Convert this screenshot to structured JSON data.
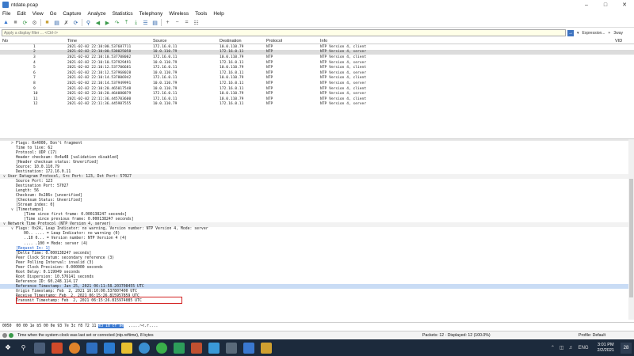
{
  "window": {
    "title": "ntdate.pcap"
  },
  "menu": [
    "File",
    "Edit",
    "View",
    "Go",
    "Capture",
    "Analyze",
    "Statistics",
    "Telephony",
    "Wireless",
    "Tools",
    "Help"
  ],
  "filter": {
    "placeholder": "Apply a display filter ... <Ctrl-/>",
    "expression_label": "Expression...",
    "plus_label": "+",
    "tvoy_label": "3way"
  },
  "packet_list": {
    "columns": [
      "No",
      "Time",
      "Source",
      "Destination",
      "Protocol",
      "Info",
      "VID"
    ],
    "rows": [
      {
        "no": "1",
        "time": "2021-02-02 22:10:00.537687711",
        "src": "172.16.0.11",
        "dst": "10.0.110.79",
        "proto": "NTP",
        "info": "NTP Version 4, client"
      },
      {
        "no": "2",
        "time": "2021-02-02 22:10:00.538025058",
        "src": "10.0.110.79",
        "dst": "172.16.0.11",
        "proto": "NTP",
        "info": "NTP Version 4, server"
      },
      {
        "no": "3",
        "time": "2021-02-02 22:10:10.537708002",
        "src": "172.16.0.11",
        "dst": "10.0.110.79",
        "proto": "NTP",
        "info": "NTP Version 4, client"
      },
      {
        "no": "4",
        "time": "2021-02-02 22:10:10.537929491",
        "src": "10.0.110.79",
        "dst": "172.16.0.11",
        "proto": "NTP",
        "info": "NTP Version 4, server"
      },
      {
        "no": "5",
        "time": "2021-02-02 22:10:12.537706681",
        "src": "172.16.0.11",
        "dst": "10.0.110.79",
        "proto": "NTP",
        "info": "NTP Version 4, client"
      },
      {
        "no": "6",
        "time": "2021-02-02 22:10:12.537968028",
        "src": "10.0.110.79",
        "dst": "172.16.0.11",
        "proto": "NTP",
        "info": "NTP Version 4, server"
      },
      {
        "no": "7",
        "time": "2021-02-02 22:10:14.537806942",
        "src": "172.16.0.11",
        "dst": "10.0.110.79",
        "proto": "NTP",
        "info": "NTP Version 4, client"
      },
      {
        "no": "8",
        "time": "2021-02-02 22:10:14.537949991",
        "src": "10.0.110.79",
        "dst": "172.16.0.11",
        "proto": "NTP",
        "info": "NTP Version 4, server"
      },
      {
        "no": "9",
        "time": "2021-02-02 22:10:20.465017548",
        "src": "10.0.110.79",
        "dst": "172.16.0.11",
        "proto": "NTP",
        "info": "NTP Version 4, client"
      },
      {
        "no": "10",
        "time": "2021-02-02 22:10:20.464080879",
        "src": "172.16.0.11",
        "dst": "10.0.110.79",
        "proto": "NTP",
        "info": "NTP Version 4, server"
      },
      {
        "no": "11",
        "time": "2021-02-02 22:11:36.445703600",
        "src": "172.16.0.11",
        "dst": "10.0.110.79",
        "proto": "NTP",
        "info": "NTP Version 4, client"
      },
      {
        "no": "12",
        "time": "2021-02-02 22:11:36.445987555",
        "src": "10.0.110.79",
        "dst": "172.16.0.11",
        "proto": "NTP",
        "info": "NTP Version 4, server"
      }
    ]
  },
  "details": [
    {
      "indent": 1,
      "arrow": ">",
      "text": "Flags: 0x4000, Don't fragment"
    },
    {
      "indent": 1,
      "arrow": "",
      "text": "Time to live: 62"
    },
    {
      "indent": 1,
      "arrow": "",
      "text": "Protocol: UDP (17)"
    },
    {
      "indent": 1,
      "arrow": "",
      "text": "Header checksum: 0x4a48 [validation disabled]"
    },
    {
      "indent": 1,
      "arrow": "",
      "text": "[Header checksum status: Unverified]"
    },
    {
      "indent": 1,
      "arrow": "",
      "text": "Source: 10.0.110.79"
    },
    {
      "indent": 1,
      "arrow": "",
      "text": "Destination: 172.16.0.11"
    },
    {
      "indent": 0,
      "arrow": "v",
      "text": "User Datagram Protocol, Src Port: 123, Dst Port: 57027",
      "hdr": true
    },
    {
      "indent": 1,
      "arrow": "",
      "text": "Source Port: 123"
    },
    {
      "indent": 1,
      "arrow": "",
      "text": "Destination Port: 57027"
    },
    {
      "indent": 1,
      "arrow": "",
      "text": "Length: 56"
    },
    {
      "indent": 1,
      "arrow": "",
      "text": "Checksum: 0x286c [unverified]"
    },
    {
      "indent": 1,
      "arrow": "",
      "text": "[Checksum Status: Unverified]"
    },
    {
      "indent": 1,
      "arrow": "",
      "text": "[Stream index: 0]"
    },
    {
      "indent": 1,
      "arrow": "v",
      "text": "[Timestamps]"
    },
    {
      "indent": 2,
      "arrow": "",
      "text": "[Time since first frame: 0.000138247 seconds]"
    },
    {
      "indent": 2,
      "arrow": "",
      "text": "[Time since previous frame: 0.000138247 seconds]"
    },
    {
      "indent": 0,
      "arrow": "v",
      "text": "Network Time Protocol (NTP Version 4, server)",
      "hdr": true
    },
    {
      "indent": 1,
      "arrow": "v",
      "text": "Flags: 0x24, Leap Indicator: no warning, Version number: NTP Version 4, Mode: server"
    },
    {
      "indent": 2,
      "arrow": "",
      "text": "00.. .... = Leap Indicator: no warning (0)"
    },
    {
      "indent": 2,
      "arrow": "",
      "text": "..10 0... = Version number: NTP Version 4 (4)"
    },
    {
      "indent": 2,
      "arrow": "",
      "text": ".... .100 = Mode: server (4)"
    },
    {
      "indent": 1,
      "arrow": "",
      "text": "[Request In: 1]",
      "link": true
    },
    {
      "indent": 1,
      "arrow": "",
      "text": "[Delta Time: 0.000138247 seconds]"
    },
    {
      "indent": 1,
      "arrow": "",
      "text": "Peer Clock Stratum: secondary reference (3)"
    },
    {
      "indent": 1,
      "arrow": "",
      "text": "Peer Polling Interval: invalid (3)"
    },
    {
      "indent": 1,
      "arrow": "",
      "text": "Peer Clock Precision: 0.000000 seconds"
    },
    {
      "indent": 1,
      "arrow": "",
      "text": "Root Delay: 0.119949 seconds"
    },
    {
      "indent": 1,
      "arrow": "",
      "text": "Root Dispersion: 10.576141 seconds"
    },
    {
      "indent": 1,
      "arrow": "",
      "text": "Reference ID: 60.248.114.17"
    },
    {
      "indent": 1,
      "arrow": "",
      "text": "Reference Timestamp: Jan 25, 2021 06:11:58.203708455 UTC",
      "hl": true
    },
    {
      "indent": 1,
      "arrow": "",
      "text": "Origin Timestamp: Feb  2, 2021 16:10:00.537807400 UTC"
    },
    {
      "indent": 1,
      "arrow": "",
      "text": "Receive Timestamp: Feb  2, 2021 06:15:26.815957859 UTC"
    },
    {
      "indent": 1,
      "arrow": "",
      "text": "Transmit Timestamp: Feb  2, 2021 06:15:26.815974085 UTC"
    }
  ],
  "hex": {
    "offset": "0050",
    "bytes": "00 00 1e b5 00 0e 93 7e  3c f8 72 11",
    "sel_bytes": "e3 1d cf ae",
    "ascii": "  .....~<.r...."
  },
  "status": {
    "message": "Time when the system clock was last set or corrected (ntp.reftime), 8 bytes",
    "packets": "Packets: 12 · Displayed: 12 (100.0%)",
    "profile": "Profile: Default"
  },
  "taskbar": {
    "time": "3:01 PM",
    "date": "2/2/2021",
    "lang": "ENG",
    "notif_count": "28"
  },
  "colors": {
    "accent": "#3a78d0",
    "highlight_box": "#d32020",
    "selected_row": "#dcdcdc",
    "taskbar": "#1c2a3c"
  }
}
